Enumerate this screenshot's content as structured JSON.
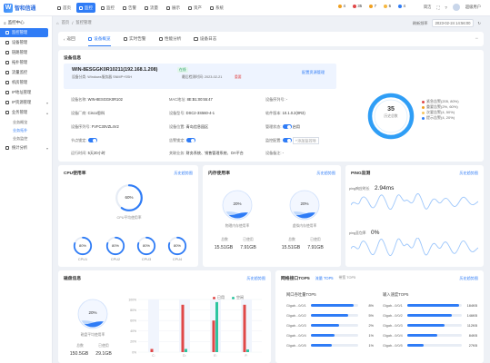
{
  "app": {
    "logo_text": "智和信通",
    "logo_mark": "W"
  },
  "topnav": [
    {
      "label": "首页"
    },
    {
      "label": "监控"
    },
    {
      "label": "监控"
    },
    {
      "label": "告警"
    },
    {
      "label": "流量"
    },
    {
      "label": "展示"
    },
    {
      "label": "资产"
    },
    {
      "label": "系统"
    }
  ],
  "alerts": [
    {
      "count": "4",
      "color": "#f0a020"
    },
    {
      "count": "35",
      "color": "#e04848"
    },
    {
      "count": "7",
      "color": "#f0a020"
    },
    {
      "count": "6",
      "color": "#f5b740"
    },
    {
      "count": "4",
      "color": "#2f7cf6"
    }
  ],
  "top_right": {
    "mode": "简洁",
    "user": "超级用户"
  },
  "sidebar": {
    "title": "监控中心",
    "items": [
      {
        "label": "监控管理",
        "active": true
      },
      {
        "label": "设备管理"
      },
      {
        "label": "链路管理"
      },
      {
        "label": "拓扑管理"
      },
      {
        "label": "流量监控"
      },
      {
        "label": "机房管理"
      },
      {
        "label": "IP地址管理"
      },
      {
        "label": "IP资源管理"
      },
      {
        "label": "业务管理"
      }
    ],
    "subitems": [
      {
        "label": "业务概览"
      },
      {
        "label": "业务拓扑",
        "active": true
      },
      {
        "label": "业务监控"
      }
    ],
    "footer": "统计分析"
  },
  "breadcrumb": {
    "home": "首页",
    "current": "监控管理"
  },
  "date_bar": {
    "refresh": "刷新频率",
    "date": "2023-02-24 14:56:00"
  },
  "tabs": {
    "back": "返回",
    "items": [
      {
        "label": "设备概览"
      },
      {
        "label": "实时告警"
      },
      {
        "label": "性能分析"
      },
      {
        "label": "设备日志"
      }
    ]
  },
  "device_info": {
    "title": "设备信息",
    "name": "WIN-8ESGGK0R10211(192.168.1.208)",
    "status": "在线",
    "meta": "设备分类: Windows服务器  SNMP+SSH",
    "last_check": "最后检测时间: 2023-02-21",
    "level": "重要",
    "config_link": "配置资源管理",
    "fields": [
      {
        "k": "设备名称",
        "v": "WIN-8ESGGK0R102"
      },
      {
        "k": "MAC地址",
        "v": "8E:B1:00:55:47"
      },
      {
        "k": "设备序列号",
        "v": "-"
      },
      {
        "k": "设备厂商",
        "v": "Cisco思科"
      },
      {
        "k": "设备型号",
        "v": "DSC2-3S560-4-1"
      },
      {
        "k": "软件版本",
        "v": "10.1.0.2(0R3)"
      },
      {
        "k": "设备序列号",
        "v": "FVFC30VZL4V2"
      },
      {
        "k": "设备位置",
        "v": "青岛信息园区"
      },
      {
        "k": "管理状态",
        "v": "启用"
      },
      {
        "k": "节点锁定",
        "v": ""
      },
      {
        "k": "告警锁定",
        "v": ""
      },
      {
        "k": "监控配置",
        "v": "+添加监控项"
      },
      {
        "k": "运行时间",
        "v": "5天20小时"
      },
      {
        "k": "关联业务",
        "v": "财务系统、销售管理系统、OA平台"
      },
      {
        "k": "设备备注",
        "v": "-"
      }
    ],
    "donut_value": "35",
    "donut_label": "历史总数",
    "legend": [
      {
        "label": "紧急告警(205, 80%)",
        "color": "#e04848"
      },
      {
        "label": "重要告警(2%, 60%)",
        "color": "#f0a020"
      },
      {
        "label": "次要告警(4, 50%)",
        "color": "#f5c560"
      },
      {
        "label": "提示告警(4, 20%)",
        "color": "#2f7cf6"
      }
    ]
  },
  "cpu": {
    "title": "CPU使用率",
    "link": "历史趋势图",
    "main_value": "60%",
    "main_label": "CPU平均使用率",
    "cores": [
      {
        "v": "80%",
        "l": "CPU1"
      },
      {
        "v": "80%",
        "l": "CPU2"
      },
      {
        "v": "80%",
        "l": "CPU3"
      },
      {
        "v": "80%",
        "l": "CPU4"
      }
    ],
    "main_fill": 0.6,
    "core_fill": 0.8
  },
  "memory": {
    "title": "内存使用率",
    "link": "历史趋势图",
    "a_value": "20%",
    "a_label": "物理内存使用率",
    "b_value": "20%",
    "b_label": "虚拟内存使用率",
    "a_total": "15.51GB",
    "a_used": "7.91GB",
    "b_total": "15.51GB",
    "b_used": "7.91GB",
    "total_label": "总数",
    "used_label": "已使用",
    "fill": 0.2
  },
  "ping": {
    "title": "PING监测",
    "link": "历史趋势图",
    "latency_label": "ping响应时长",
    "latency_value": "2.94ms",
    "loss_label": "ping丢包率",
    "loss_value": "0%"
  },
  "disk": {
    "title": "磁盘信息",
    "link": "历史趋势图",
    "value": "20%",
    "label": "磁盘平均使用率",
    "total_label": "总数",
    "total": "150.5GB",
    "used_label": "已使用",
    "used": "29.1GB",
    "legend_used": "已用",
    "legend_free": "空闲",
    "fill": 0.2
  },
  "chart_data": {
    "type": "bar",
    "title": "",
    "categories": [
      "C:",
      "D:",
      "E:",
      "F:"
    ],
    "series": [
      {
        "name": "已用",
        "values": [
          6,
          90,
          60,
          90
        ],
        "color": "#e04848"
      },
      {
        "name": "空闲",
        "values": [
          0,
          6,
          95,
          5
        ],
        "color": "#2ec5a0"
      }
    ],
    "ylim": [
      0,
      100
    ],
    "yticks": [
      "100%",
      "80%",
      "60%",
      "40%",
      "20%",
      "0%"
    ]
  },
  "net": {
    "title": "网络接口TOP5",
    "tab_in": "流量 TOP5",
    "tab_out": "带宽 TOP5",
    "in_title": "网口吞吐量TOP5",
    "out_title": "输入速度TOP5",
    "in_rows": [
      {
        "n": "Gigab...0/0/1",
        "v": "8%",
        "f": 0.9
      },
      {
        "n": "Gigab...0/0/2",
        "v": "5%",
        "f": 0.78
      },
      {
        "n": "Gigab...0/0/3",
        "v": "2%",
        "f": 0.6
      },
      {
        "n": "Gigab...0/0/4",
        "v": "1%",
        "f": 0.5
      },
      {
        "n": "Gigab...0/0/5",
        "v": "1%",
        "f": 0.45
      }
    ],
    "out_rows": [
      {
        "n": "Gigab...0/0/1",
        "v": "184KB",
        "f": 0.95
      },
      {
        "n": "Gigab...0/0/2",
        "v": "146KB",
        "f": 0.82
      },
      {
        "n": "Gigab...0/0/3",
        "v": "112KB",
        "f": 0.68
      },
      {
        "n": "Gigab...0/0/4",
        "v": "84KB",
        "f": 0.55
      },
      {
        "n": "Gigab...0/0/5",
        "v": "27KB",
        "f": 0.3
      }
    ]
  }
}
